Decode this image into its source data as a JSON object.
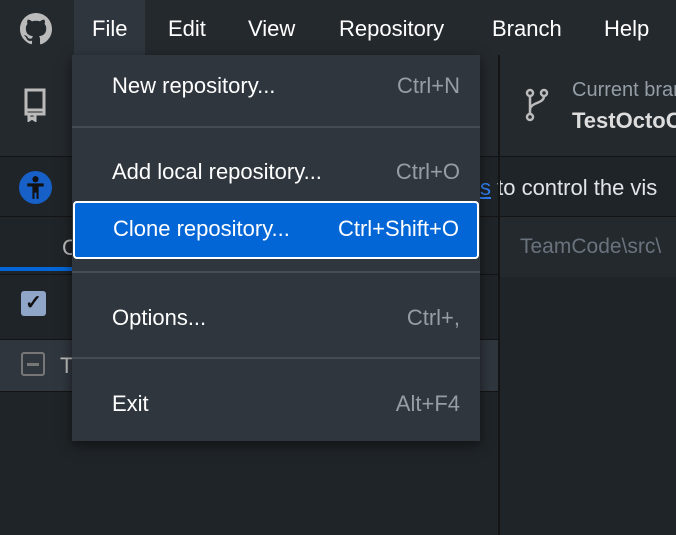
{
  "menubar": {
    "items": [
      {
        "label": "File"
      },
      {
        "label": "Edit"
      },
      {
        "label": "View"
      },
      {
        "label": "Repository"
      },
      {
        "label": "Branch"
      },
      {
        "label": "Help"
      }
    ]
  },
  "toolbar": {
    "branch_label": "Current branch",
    "branch_name": "TestOctoC"
  },
  "banner": {
    "link": "s",
    "text": " to control the vis"
  },
  "tabs": {
    "first": "C"
  },
  "path": "TeamCode\\src\\",
  "file_row": {
    "label": "T"
  },
  "file_menu": {
    "items": [
      {
        "label": "New repository...",
        "shortcut": "Ctrl+N"
      },
      {
        "label": "Add local repository...",
        "shortcut": "Ctrl+O"
      },
      {
        "label": "Clone repository...",
        "shortcut": "Ctrl+Shift+O"
      },
      {
        "label": "Options...",
        "shortcut": "Ctrl+,"
      },
      {
        "label": "Exit",
        "shortcut": "Alt+F4"
      }
    ]
  },
  "colors": {
    "accent": "#0366d6"
  }
}
